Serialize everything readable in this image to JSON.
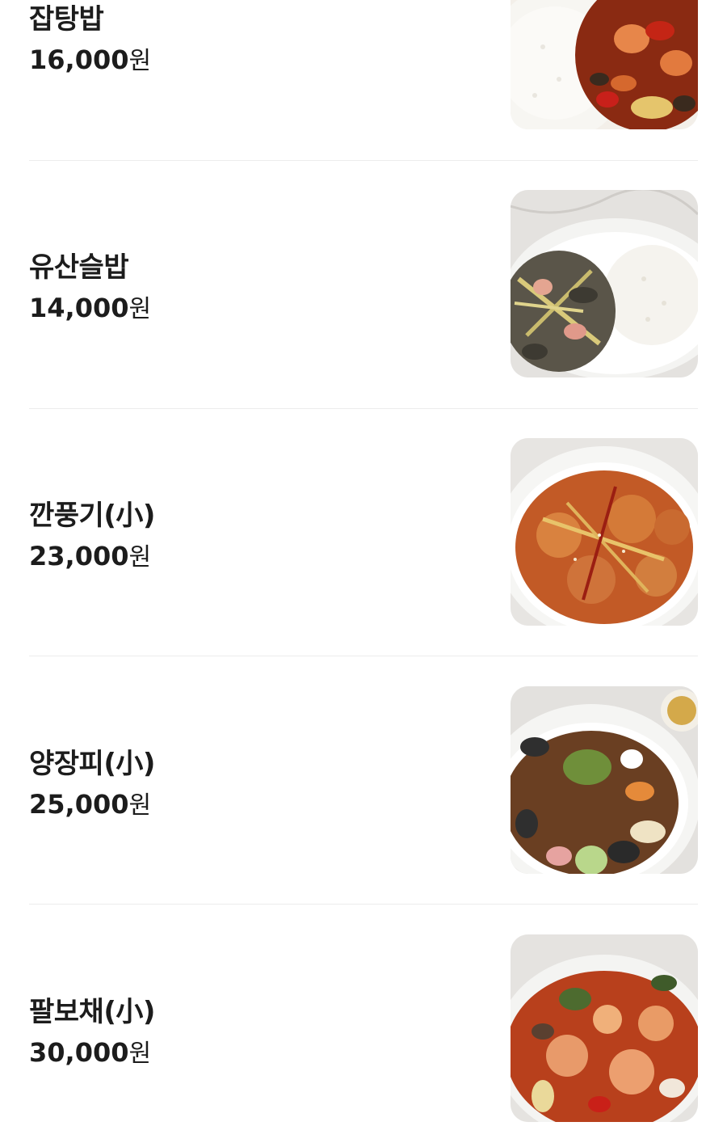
{
  "menu": {
    "items": [
      {
        "name": "잡탕밥",
        "price": "16,000",
        "currency": "원",
        "image": "japtangbap-photo"
      },
      {
        "name": "유산슬밥",
        "price": "14,000",
        "currency": "원",
        "image": "yusanseulbap-photo"
      },
      {
        "name": "깐풍기(小)",
        "price": "23,000",
        "currency": "원",
        "image": "kkanpunggi-photo"
      },
      {
        "name": "양장피(小)",
        "price": "25,000",
        "currency": "원",
        "image": "yangjangpi-photo"
      },
      {
        "name": "팔보채(小)",
        "price": "30,000",
        "currency": "원",
        "image": "palbochae-photo"
      }
    ]
  },
  "colors": {
    "text": "#1c1c1c",
    "divider": "#ececec",
    "background": "#ffffff"
  }
}
